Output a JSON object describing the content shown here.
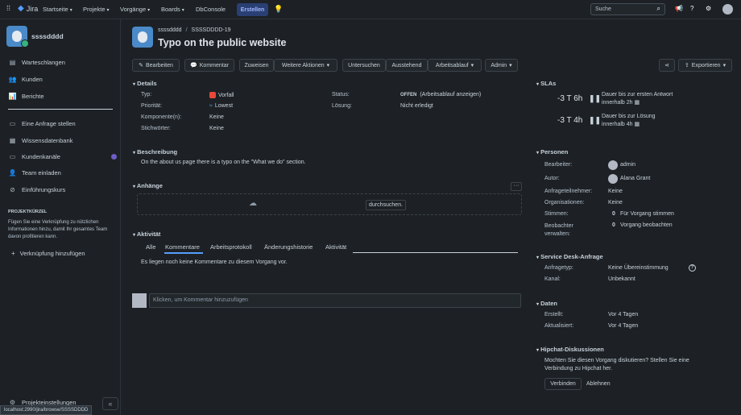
{
  "topbar": {
    "logo": "Jira",
    "nav": [
      "Startseite",
      "Projekte",
      "Vorgänge",
      "Boards",
      "DbConsole"
    ],
    "create_label": "Erstellen",
    "search_placeholder": "Suche"
  },
  "sidebar": {
    "project_name": "ssssdddd",
    "items": [
      "Warteschlangen",
      "Kunden",
      "Berichte"
    ],
    "items2": [
      "Eine Anfrage stellen",
      "Wissensdatenbank",
      "Kundenkanäle",
      "Team einladen",
      "Einführungskurs"
    ],
    "shortcuts_title": "PROJEKTKÜRZEL",
    "shortcuts_desc": "Fügen Sie eine Verknüpfung zu nützlichen Informationen hinzu, damit Ihr gesamtes Team davon profitieren kann.",
    "add_shortcut": "Verknüpfung hinzufügen",
    "project_settings": "Projekteinstellungen",
    "collapse": "«",
    "status_url": "localhost:2990/jira/browse/SSSSDDDD"
  },
  "issue": {
    "breadcrumb_project": "ssssdddd",
    "breadcrumb_sep": "/",
    "key": "SSSSDDDD-19",
    "title": "Typo on the public website"
  },
  "toolbar": {
    "edit": "Bearbeiten",
    "comment": "Kommentar",
    "assign": "Zuweisen",
    "more": "Weitere Aktionen",
    "investigate": "Untersuchen",
    "pending": "Ausstehend",
    "workflow": "Arbeitsablauf",
    "admin": "Admin",
    "export": "Exportieren"
  },
  "details": {
    "title": "Details",
    "type_label": "Typ:",
    "type_value": "Vorfall",
    "priority_label": "Priorität:",
    "priority_value": "Lowest",
    "components_label": "Komponente(n):",
    "components_value": "Keine",
    "labels_label": "Stichwörter:",
    "labels_value": "Keine",
    "status_label": "Status:",
    "status_value": "OFFEN",
    "status_link": "(Arbeitsablauf anzeigen)",
    "resolution_label": "Lösung:",
    "resolution_value": "Nicht erledigt"
  },
  "description": {
    "title": "Beschreibung",
    "text": "On the about us page there is a typo on the \"What we do\" section."
  },
  "attachments": {
    "title": "Anhänge",
    "browse": "durchsuchen."
  },
  "activity": {
    "title": "Aktivität",
    "tabs": [
      "Alle",
      "Kommentare",
      "Arbeitsprotokoll",
      "Änderungshistorie",
      "Aktivität"
    ],
    "empty": "Es liegen noch keine Kommentare zu diesem Vorgang vor.",
    "comment_placeholder": "Klicken, um Kommentar hinzuzufügen"
  },
  "slas": {
    "title": "SLAs",
    "items": [
      {
        "time": "-3 T 6h",
        "desc1": "Dauer bis zur ersten Antwort",
        "desc2": "innerhalb 2h"
      },
      {
        "time": "-3 T 4h",
        "desc1": "Dauer bis zur Lösung",
        "desc2": "innerhalb 4h"
      }
    ]
  },
  "people": {
    "title": "Personen",
    "assignee_label": "Bearbeiter:",
    "assignee_value": "admin",
    "reporter_label": "Autor:",
    "reporter_value": "Alana Grant",
    "participants_label": "Anfrageteilnehmer:",
    "participants_value": "Keine",
    "orgs_label": "Organisationen:",
    "orgs_value": "Keine",
    "votes_label": "Stimmen:",
    "votes_count": "0",
    "votes_link": "Für Vorgang stimmen",
    "watchers_label": "Beobachter",
    "watchers_label2": "verwalten:",
    "watchers_count": "0",
    "watchers_link": "Vorgang beobachten"
  },
  "servicedesk": {
    "title": "Service Desk-Anfrage",
    "type_label": "Anfragetyp:",
    "type_value": "Keine Übereinstimmung",
    "channel_label": "Kanal:",
    "channel_value": "Unbekannt"
  },
  "dates": {
    "title": "Daten",
    "created_label": "Erstellt:",
    "created_value": "Vor 4 Tagen",
    "updated_label": "Aktualisiert:",
    "updated_value": "Vor 4 Tagen"
  },
  "hipchat": {
    "title": "Hipchat-Diskussionen",
    "text1": "Mochten Sie diesen Vorgang diskutieren? Stellen Sie eine",
    "text2": "Verbindung zu Hipchat her.",
    "connect": "Verbinden",
    "decline": "Ablehnen"
  },
  "colors": {
    "accent": "#579dff",
    "bg": "#1d2125",
    "create": "#2a3f73"
  }
}
